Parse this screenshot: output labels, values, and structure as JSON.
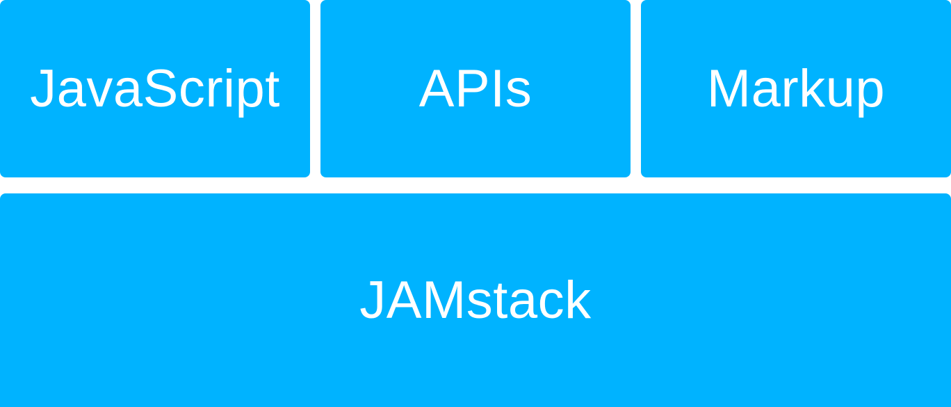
{
  "blocks": {
    "javascript": "JavaScript",
    "apis": "APIs",
    "markup": "Markup",
    "jamstack": "JAMstack"
  },
  "colors": {
    "block_fill": "#00b3ff",
    "text": "#ffffff",
    "background": "#ffffff"
  }
}
